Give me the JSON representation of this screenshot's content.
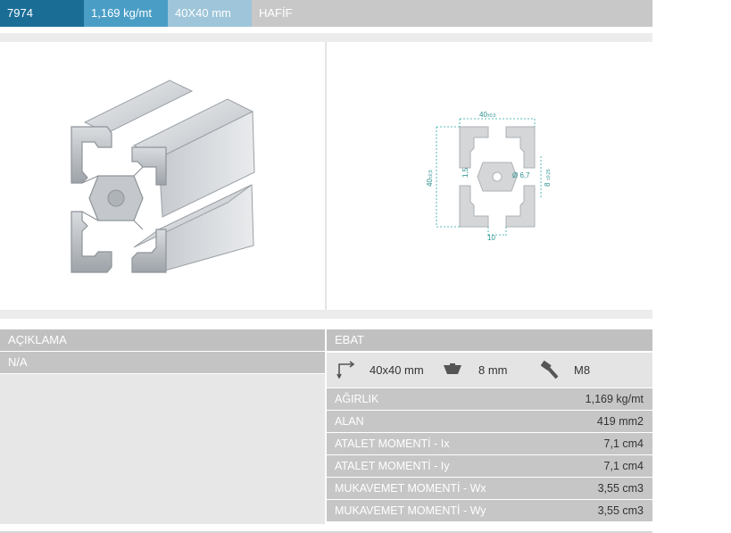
{
  "topbar": {
    "code": "7974",
    "weight": "1,169 kg/mt",
    "size": "40X40 mm",
    "type": "HAFİF"
  },
  "drawing": {
    "width_label": "40",
    "width_tol": "±0,5",
    "height_label": "40",
    "height_tol": "±0,5",
    "wall_label": "1,5",
    "bore_label": "Ø 6,7",
    "slot_label": "8",
    "slot_tol": "±0,25",
    "bottom_label": "10"
  },
  "description": {
    "header": "AÇIKLAMA",
    "value": "N/A"
  },
  "dimensions": {
    "header": "EBAT",
    "size": "40x40 mm",
    "slot": "8 mm",
    "bolt": "M8"
  },
  "properties": [
    {
      "key": "AĞIRLIK",
      "value": "1,169 kg/mt"
    },
    {
      "key": "ALAN",
      "value": "419 mm2"
    },
    {
      "key": "ATALET MOMENTİ - Ix",
      "value": "7,1 cm4"
    },
    {
      "key": "ATALET MOMENTİ - Iy",
      "value": "7,1 cm4"
    },
    {
      "key": "MUKAVEMET MOMENTİ - Wx",
      "value": "3,55 cm3"
    },
    {
      "key": "MUKAVEMET MOMENTİ - Wy",
      "value": "3,55 cm3"
    }
  ]
}
